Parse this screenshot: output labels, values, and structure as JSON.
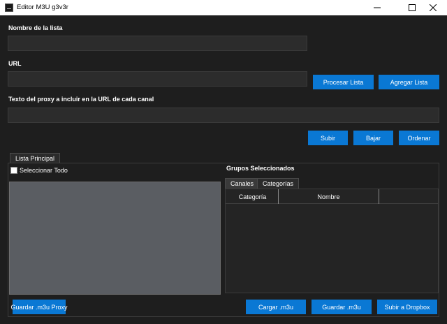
{
  "window": {
    "title": "Editor M3U g3v3r",
    "minimize_icon": "minimize-icon",
    "maximize_icon": "maximize-icon",
    "close_icon": "close-icon"
  },
  "form": {
    "list_name_label": "Nombre de la lista",
    "list_name_value": "",
    "url_label": "URL",
    "url_value": "",
    "proxy_label": "Texto del proxy a incluir en la URL de cada canal",
    "proxy_value": ""
  },
  "buttons": {
    "process_list": "Procesar Lista",
    "add_list": "Agregar Lista",
    "up": "Subir",
    "down": "Bajar",
    "sort": "Ordenar",
    "save_proxy": "Guardar .m3u Proxy",
    "load": "Cargar .m3u",
    "save": "Guardar .m3u",
    "dropbox": "Subir a Dropbox"
  },
  "main_tab": {
    "label": "Lista Principal",
    "select_all_label": "Seleccionar Todo",
    "select_all_checked": false
  },
  "groups": {
    "title": "Grupos Seleccionados",
    "tabs": [
      {
        "label": "Canales",
        "active": true
      },
      {
        "label": "Categorías",
        "active": false
      }
    ],
    "columns": [
      "Categoría",
      "Nombre"
    ]
  },
  "colors": {
    "accent": "#0a78d4",
    "background": "#1e1e1e",
    "input": "#2c2c2c",
    "list": "#5a5d62"
  }
}
